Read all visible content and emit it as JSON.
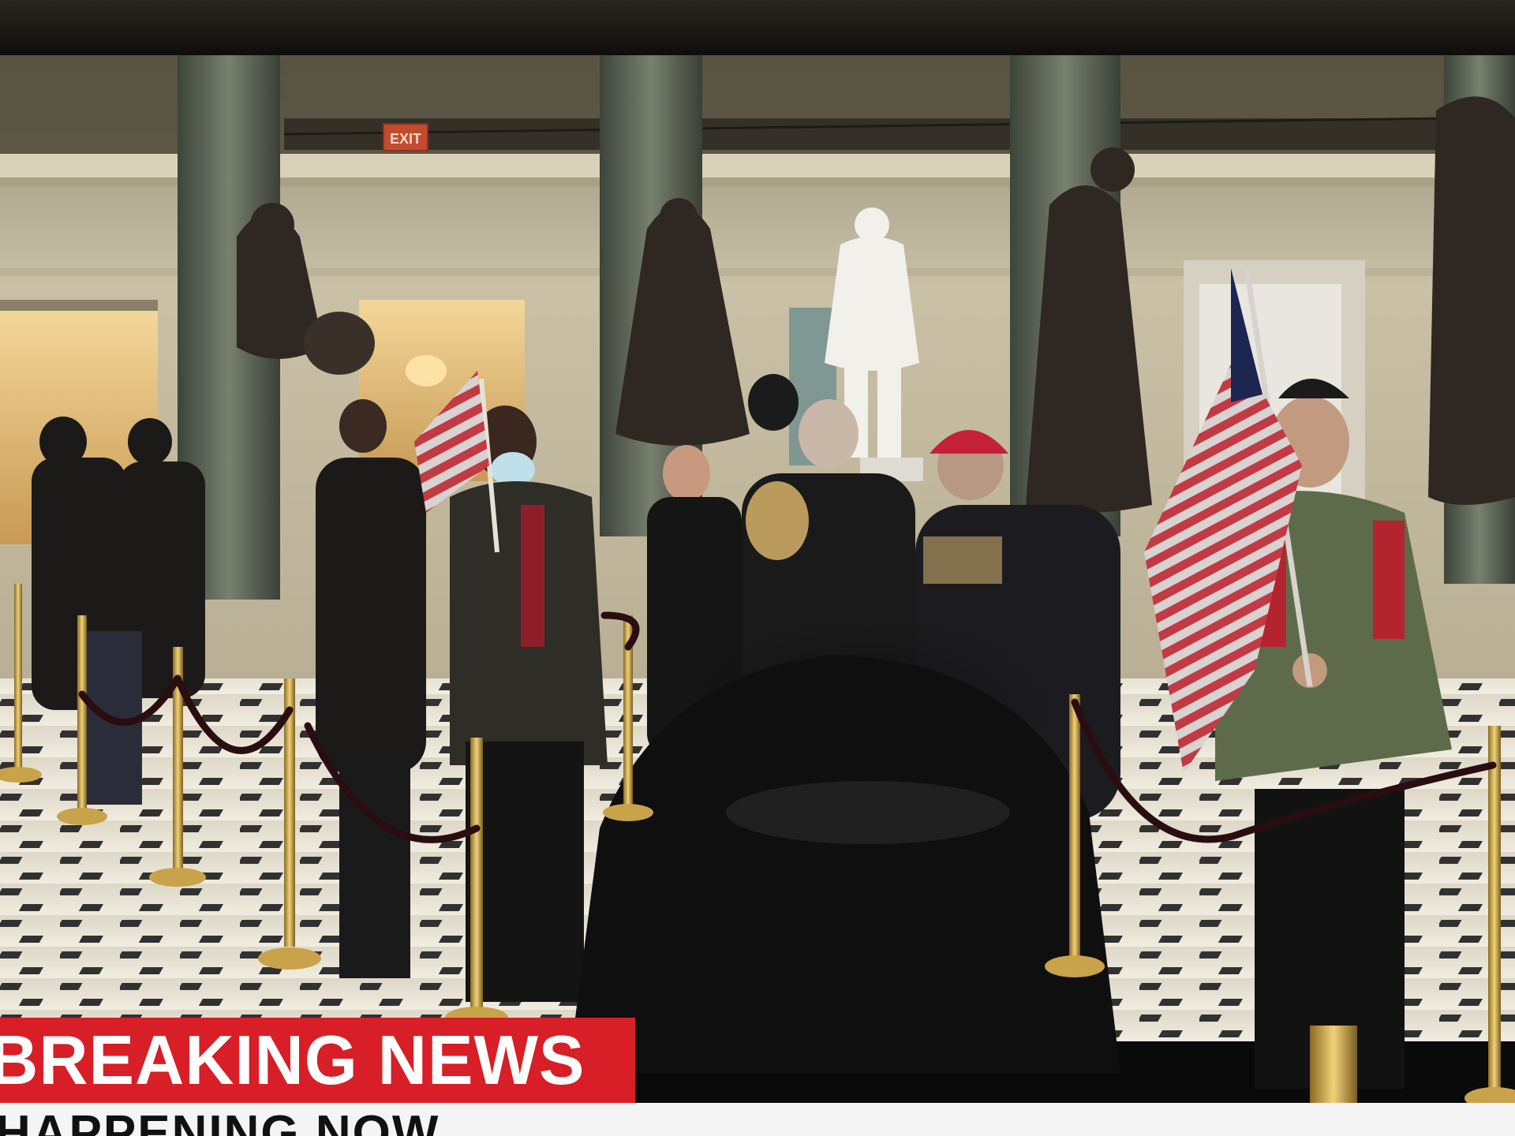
{
  "broadcast": {
    "lower_third": {
      "text": "BREAKING NEWS",
      "color": "#d81e26"
    },
    "ticker": {
      "text": "HAPPENING NOW"
    },
    "exit_sign": {
      "text": "EXIT"
    }
  },
  "scene": {
    "description_colors": {
      "wall": "#cfc6ad",
      "column": "#5e6659",
      "floor_light": "#e8e2d2",
      "floor_tile": "#111111",
      "stanchion": "#c9a34a",
      "rope": "#2a0d10",
      "cap": "#d0203a"
    }
  }
}
